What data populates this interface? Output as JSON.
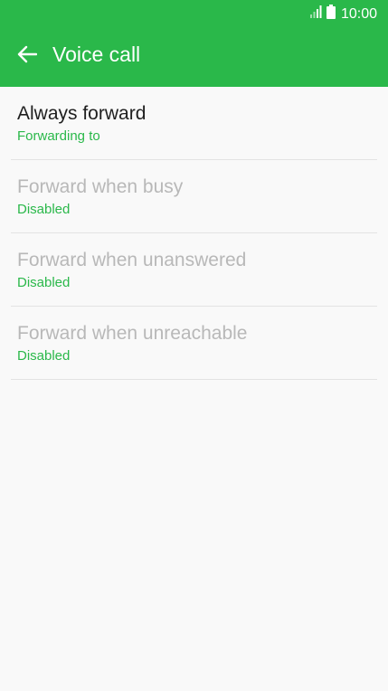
{
  "status_bar": {
    "time": "10:00",
    "signal_icon": "signal-icon",
    "battery_icon": "battery-icon"
  },
  "toolbar": {
    "back_icon": "arrow-back-icon",
    "title": "Voice call"
  },
  "colors": {
    "accent": "#2ab84a",
    "background": "#f9f9f9",
    "title_text": "#1f1f1f",
    "disabled_text": "#b8b8b8",
    "divider": "#e3e3e3"
  },
  "forward_options": [
    {
      "title": "Always forward",
      "status": "Forwarding to",
      "enabled": true
    },
    {
      "title": "Forward when busy",
      "status": "Disabled",
      "enabled": false
    },
    {
      "title": "Forward when unanswered",
      "status": "Disabled",
      "enabled": false
    },
    {
      "title": "Forward when unreachable",
      "status": "Disabled",
      "enabled": false
    }
  ]
}
